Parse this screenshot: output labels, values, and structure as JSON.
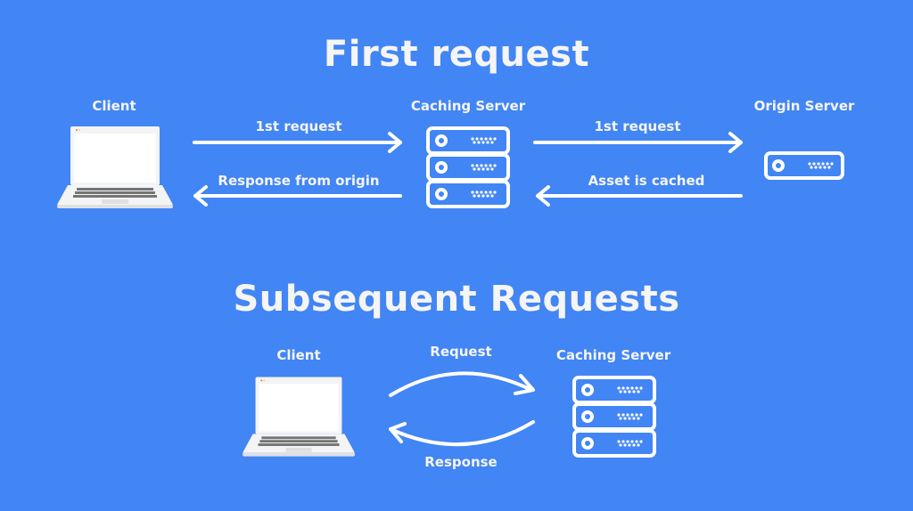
{
  "section1": {
    "title": "First request",
    "nodes": {
      "client": "Client",
      "caching_server": "Caching Server",
      "origin_server": "Origin Server"
    },
    "arrows": {
      "client_to_cache": "1st request",
      "cache_to_client": "Response from origin",
      "cache_to_origin": "1st request",
      "origin_to_cache": "Asset is cached"
    }
  },
  "section2": {
    "title": "Subsequent Requests",
    "nodes": {
      "client": "Client",
      "caching_server": "Caching Server"
    },
    "arrows": {
      "request": "Request",
      "response": "Response"
    }
  },
  "colors": {
    "background": "#4285f4",
    "foreground": "#ffffff"
  }
}
